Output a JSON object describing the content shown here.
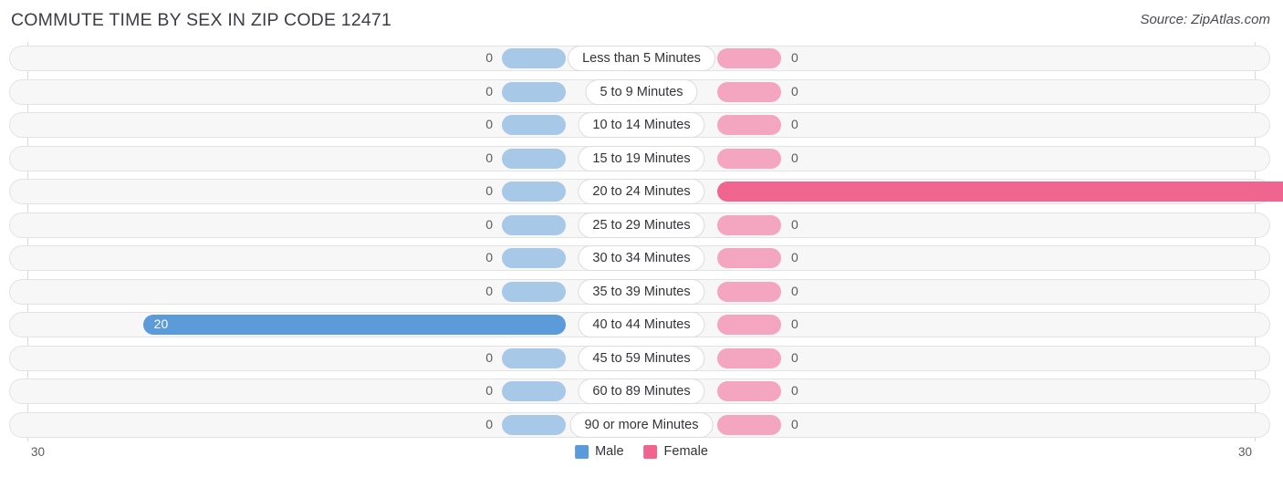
{
  "header": {
    "title": "COMMUTE TIME BY SEX IN ZIP CODE 12471",
    "source": "Source: ZipAtlas.com"
  },
  "legend": {
    "male_label": "Male",
    "female_label": "Female",
    "male_color": "#5b9bd9",
    "female_color": "#f0658f"
  },
  "axis": {
    "left_label": "30",
    "right_label": "30",
    "max": 30
  },
  "chart_data": {
    "type": "bar",
    "title": "COMMUTE TIME BY SEX IN ZIP CODE 12471",
    "orientation": "horizontal-diverging",
    "xlabel": "",
    "ylabel": "",
    "xlim": [
      30,
      30
    ],
    "grid": true,
    "legend_position": "bottom-center",
    "categories": [
      "Less than 5 Minutes",
      "5 to 9 Minutes",
      "10 to 14 Minutes",
      "15 to 19 Minutes",
      "20 to 24 Minutes",
      "25 to 29 Minutes",
      "30 to 34 Minutes",
      "35 to 39 Minutes",
      "40 to 44 Minutes",
      "45 to 59 Minutes",
      "60 to 89 Minutes",
      "90 or more Minutes"
    ],
    "series": [
      {
        "name": "Male",
        "values": [
          0,
          0,
          0,
          0,
          0,
          0,
          0,
          0,
          20,
          0,
          0,
          0
        ]
      },
      {
        "name": "Female",
        "values": [
          0,
          0,
          0,
          0,
          30,
          0,
          0,
          0,
          0,
          0,
          0,
          0
        ]
      }
    ]
  },
  "rows": [
    {
      "label": "Less than 5 Minutes",
      "male": "0",
      "female": "0"
    },
    {
      "label": "5 to 9 Minutes",
      "male": "0",
      "female": "0"
    },
    {
      "label": "10 to 14 Minutes",
      "male": "0",
      "female": "0"
    },
    {
      "label": "15 to 19 Minutes",
      "male": "0",
      "female": "0"
    },
    {
      "label": "20 to 24 Minutes",
      "male": "0",
      "female": "30"
    },
    {
      "label": "25 to 29 Minutes",
      "male": "0",
      "female": "0"
    },
    {
      "label": "30 to 34 Minutes",
      "male": "0",
      "female": "0"
    },
    {
      "label": "35 to 39 Minutes",
      "male": "0",
      "female": "0"
    },
    {
      "label": "40 to 44 Minutes",
      "male": "20",
      "female": "0"
    },
    {
      "label": "45 to 59 Minutes",
      "male": "0",
      "female": "0"
    },
    {
      "label": "60 to 89 Minutes",
      "male": "0",
      "female": "0"
    },
    {
      "label": "90 or more Minutes",
      "male": "0",
      "female": "0"
    }
  ]
}
